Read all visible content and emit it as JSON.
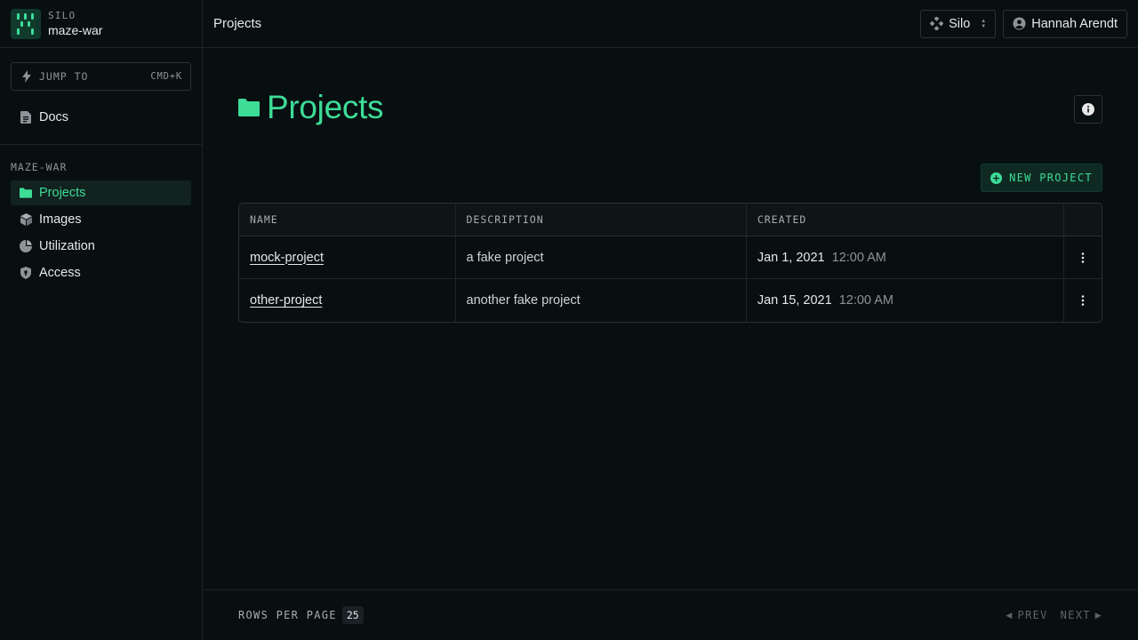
{
  "sidebar": {
    "silo_label": "SILO",
    "silo_name": "maze-war",
    "jump": {
      "label": "JUMP TO",
      "shortcut": "CMD+K"
    },
    "docs_label": "Docs",
    "section_label": "MAZE-WAR",
    "items": [
      {
        "label": "Projects",
        "icon": "folder-icon",
        "active": true
      },
      {
        "label": "Images",
        "icon": "cube-icon",
        "active": false
      },
      {
        "label": "Utilization",
        "icon": "pie-chart-icon",
        "active": false
      },
      {
        "label": "Access",
        "icon": "shield-icon",
        "active": false
      }
    ]
  },
  "topbar": {
    "breadcrumb": "Projects",
    "silo_picker": "Silo",
    "user_name": "Hannah Arendt"
  },
  "main": {
    "title": "Projects",
    "new_button": "NEW PROJECT"
  },
  "table": {
    "headers": [
      "NAME",
      "DESCRIPTION",
      "CREATED"
    ],
    "rows": [
      {
        "name": "mock-project",
        "description": "a fake project",
        "date": "Jan 1, 2021",
        "time": "12:00 AM"
      },
      {
        "name": "other-project",
        "description": "another fake project",
        "date": "Jan 15, 2021",
        "time": "12:00 AM"
      }
    ]
  },
  "footer": {
    "rows_per_page_label": "ROWS PER PAGE",
    "rows_per_page_value": "25",
    "prev": "PREV",
    "next": "NEXT"
  },
  "colors": {
    "accent": "#3ddc97",
    "background": "#080f11",
    "border": "#2b3235"
  }
}
